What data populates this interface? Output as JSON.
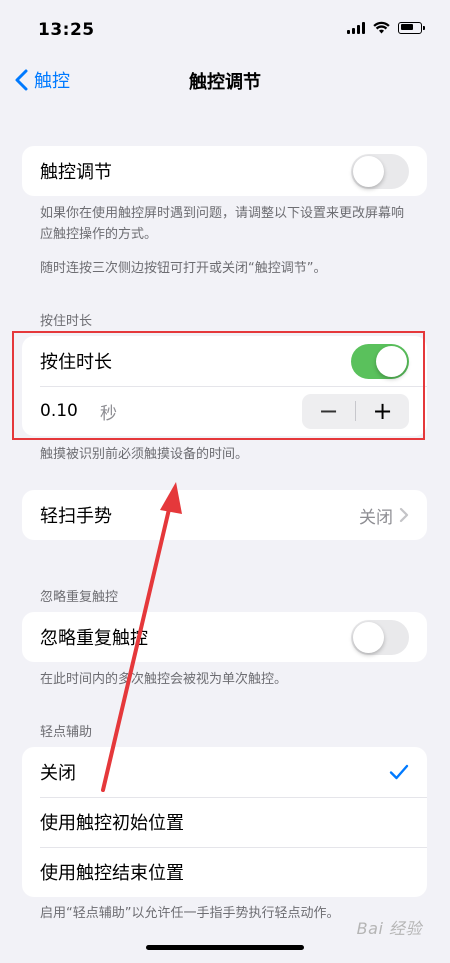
{
  "status_bar": {
    "time": "13:25"
  },
  "nav": {
    "back_label": "触控",
    "title": "触控调节"
  },
  "touch_accommodations": {
    "label": "触控调节",
    "enabled": false,
    "footer_1": "如果你在使用触控屏时遇到问题，请调整以下设置来更改屏幕响应触控操作的方式。",
    "footer_2": "随时连按三次侧边按钮可打开或关闭“触控调节”。"
  },
  "hold_duration": {
    "header": "按住时长",
    "label": "按住时长",
    "enabled": true,
    "value": "0.10",
    "unit": "秒",
    "minus": "−",
    "plus": "+",
    "footer": "触摸被识别前必须触摸设备的时间。"
  },
  "swipe_gestures": {
    "label": "轻扫手势",
    "value": "关闭"
  },
  "ignore_repeat": {
    "header": "忽略重复触控",
    "label": "忽略重复触控",
    "enabled": false,
    "footer": "在此时间内的多次触控会被视为单次触控。"
  },
  "tap_assistance": {
    "header": "轻点辅助",
    "options": [
      "关闭",
      "使用触控初始位置",
      "使用触控结束位置"
    ],
    "selected": "关闭",
    "footer": "启用“轻点辅助”以允许任一手指手势执行轻点动作。"
  },
  "watermark": "Bai 经验",
  "colors": {
    "accent": "#007aff",
    "toggle_on": "#5ac15c",
    "highlight": "#e5383b"
  }
}
